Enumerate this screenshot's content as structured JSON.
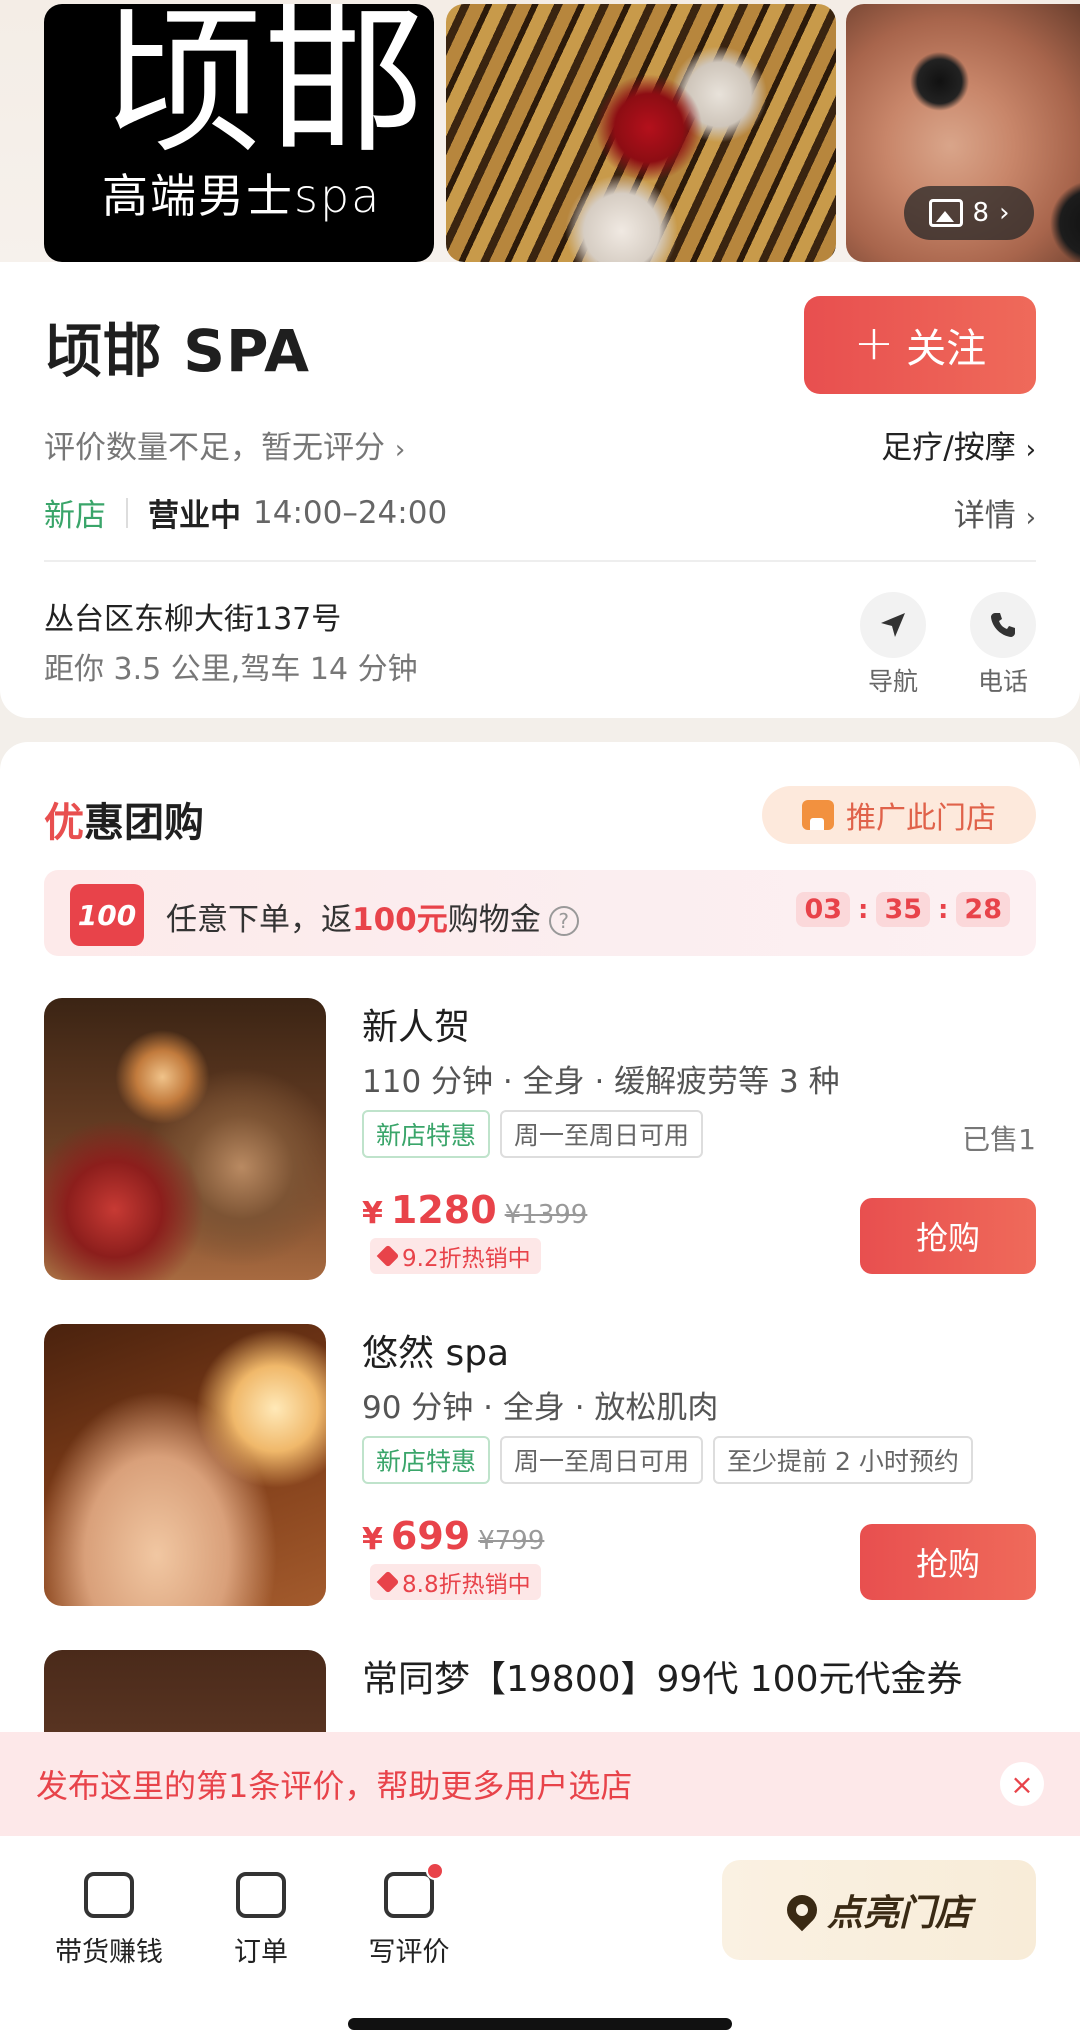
{
  "gallery": {
    "logo_main": "顷邯",
    "logo_sub": "高端男士spa",
    "photo_count": "8"
  },
  "shop": {
    "name": "顷邯 SPA",
    "follow_label": "关注",
    "rating_note": "评价数量不足，暂无评分",
    "category": "足疗/按摩",
    "new_tag": "新店",
    "open_status": "营业中",
    "hours": "14:00–24:00",
    "details_label": "详情",
    "address": "丛台区东柳大街137号",
    "distance": "距你 3.5 公里,驾车 14 分钟",
    "nav_label": "导航",
    "phone_label": "电话"
  },
  "deals_section": {
    "title_first": "优",
    "title_rest": "惠团购",
    "promote_label": "推广此门店",
    "banner": {
      "badge": "100",
      "text_before": "任意下单，返",
      "highlight": "100元",
      "text_after": "购物金",
      "countdown": [
        "03",
        "35",
        "28"
      ]
    },
    "items": [
      {
        "name": "新人贺",
        "desc": "110 分钟 · 全身 · 缓解疲劳等 3 种",
        "tags": [
          "新店特惠",
          "周一至周日可用"
        ],
        "sold": "已售1",
        "currency": "¥",
        "price": "1280",
        "original": "¥1399",
        "discount": "9.2折热销中",
        "buy_label": "抢购"
      },
      {
        "name": "悠然 spa",
        "desc": "90 分钟 · 全身 · 放松肌肉",
        "tags": [
          "新店特惠",
          "周一至周日可用",
          "至少提前 2 小时预约"
        ],
        "currency": "¥",
        "price": "699",
        "original": "¥799",
        "discount": "8.8折热销中",
        "buy_label": "抢购"
      },
      {
        "name": "常同梦【19800】99代 100元代金券"
      }
    ]
  },
  "review_prompt": {
    "text": "发布这里的第1条评价，帮助更多用户选店",
    "close": "×"
  },
  "bottom_bar": {
    "tab1": "带货赚钱",
    "tab2": "订单",
    "tab3": "写评价",
    "light_button": "点亮门店"
  },
  "colors": {
    "accent": "#e8434a",
    "green": "#3aa56a"
  }
}
